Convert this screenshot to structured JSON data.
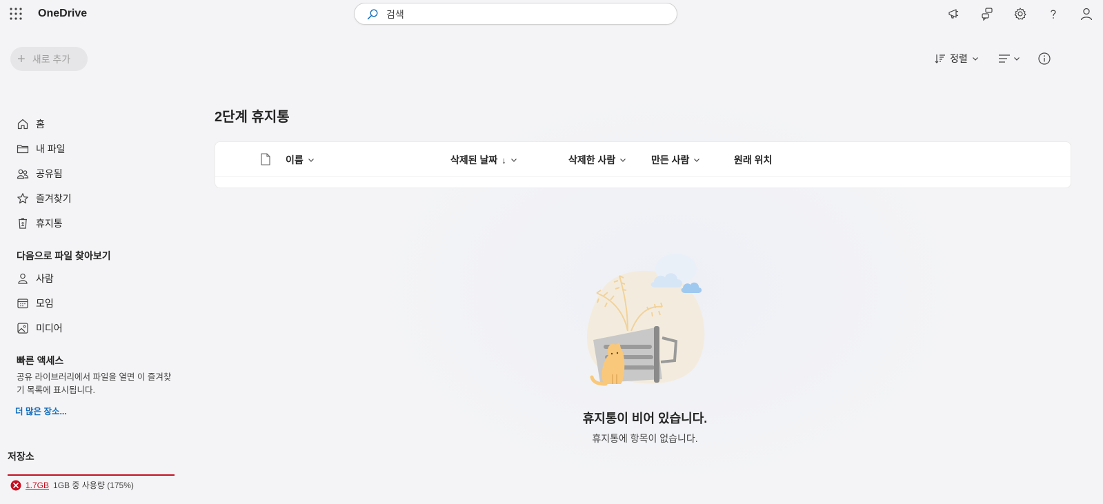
{
  "app": {
    "name": "OneDrive"
  },
  "search": {
    "placeholder": "검색"
  },
  "toolbar": {
    "new_label": "새로 추가",
    "sort_label": "정렬"
  },
  "sidebar": {
    "items": [
      {
        "label": "홈",
        "icon": "home-icon"
      },
      {
        "label": "내 파일",
        "icon": "folder-icon"
      },
      {
        "label": "공유됨",
        "icon": "people-icon"
      },
      {
        "label": "즐겨찾기",
        "icon": "star-icon"
      },
      {
        "label": "휴지통",
        "icon": "recycle-bin-icon"
      }
    ],
    "browse_heading": "다음으로 파일 찾아보기",
    "browse_items": [
      {
        "label": "사람",
        "icon": "person-icon"
      },
      {
        "label": "모임",
        "icon": "calendar-icon"
      },
      {
        "label": "미디어",
        "icon": "image-icon"
      }
    ],
    "quick_access": {
      "heading": "빠른 액세스",
      "description": "공유 라이브러리에서 파일을 열면 이 즐겨찾기 목록에 표시됩니다.",
      "more_link": "더 많은 장소..."
    },
    "storage": {
      "heading": "저장소",
      "used": "1.7GB",
      "detail": "1GB 중 사용량 (175%)",
      "usage_fraction": 1.75,
      "status_color": "#c50f1f"
    }
  },
  "main": {
    "title": "2단계 휴지통",
    "columns": {
      "name": "이름",
      "deleted_date": "삭제된 날짜",
      "deleted_date_sort": "↓",
      "deleted_by": "삭제한 사람",
      "created_by": "만든 사람",
      "original_location": "원래 위치"
    },
    "empty": {
      "title": "휴지통이 비어 있습니다.",
      "subtitle": "휴지통에 항목이 없습니다."
    }
  },
  "colors": {
    "accent": "#0f6cbd",
    "error": "#c50f1f"
  }
}
